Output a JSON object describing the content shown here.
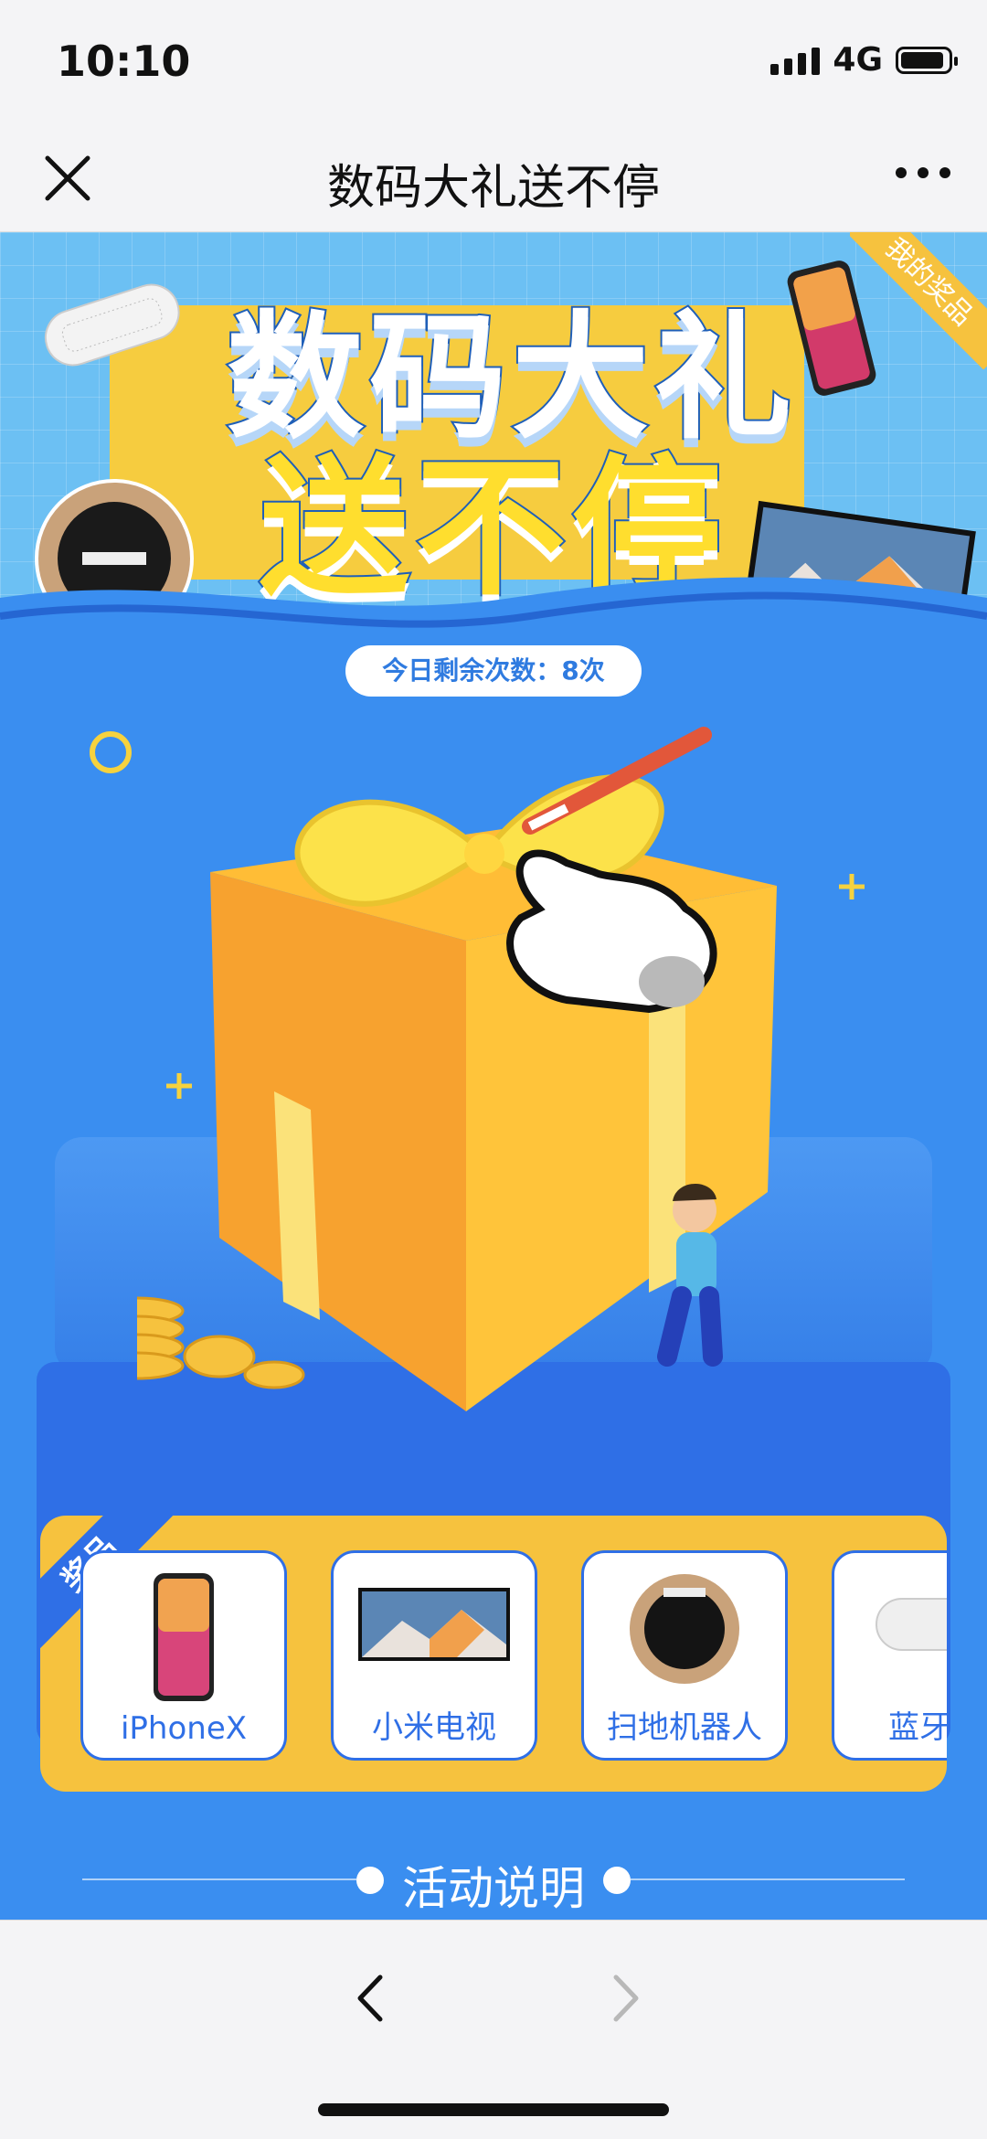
{
  "status_bar": {
    "time": "10:10",
    "network": "4G"
  },
  "nav": {
    "title": "数码大礼送不停"
  },
  "hero": {
    "title_line1": "数码大礼",
    "title_line2": "送不停",
    "my_prizes": "我的奖品"
  },
  "remaining_text": "今日剩余次数：8次",
  "prizes": {
    "label": "奖品",
    "items": [
      {
        "name": "iPhoneX"
      },
      {
        "name": "小米电视"
      },
      {
        "name": "扫地机器人"
      },
      {
        "name": "蓝牙音"
      }
    ]
  },
  "rules": {
    "title": "活动说明"
  },
  "colors": {
    "primary_blue": "#3a8ef0",
    "accent_yellow": "#f6c23e"
  }
}
